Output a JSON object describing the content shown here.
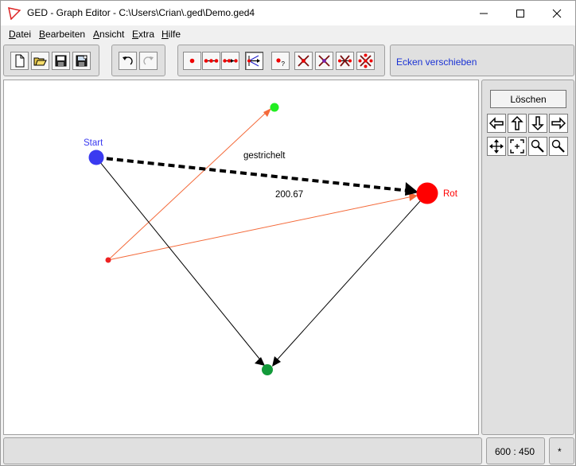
{
  "window": {
    "title": "GED - Graph Editor - C:\\Users\\Crian\\.ged\\Demo.ged4"
  },
  "menu": {
    "items": [
      "Datei",
      "Bearbeiten",
      "Ansicht",
      "Extra",
      "Hilfe"
    ]
  },
  "toolbar": {
    "status": "Ecken verschieben"
  },
  "canvas": {
    "nodes": [
      {
        "label": "Start",
        "color": "#3a3af0"
      },
      {
        "label": "Rot",
        "color": "#ff0000"
      },
      {
        "label": "",
        "color": "#22ee22"
      },
      {
        "label": "",
        "color": "#ee2222"
      },
      {
        "label": "",
        "color": "#139a3a"
      }
    ],
    "edge_labels": {
      "dashed": "gestrichelt",
      "weight": "200.67"
    },
    "edge_colors": {
      "orange": "#f46a3a",
      "black": "#000000"
    }
  },
  "side": {
    "delete_label": "Löschen"
  },
  "statusbar": {
    "coords": "600 : 450",
    "modified": "*"
  }
}
